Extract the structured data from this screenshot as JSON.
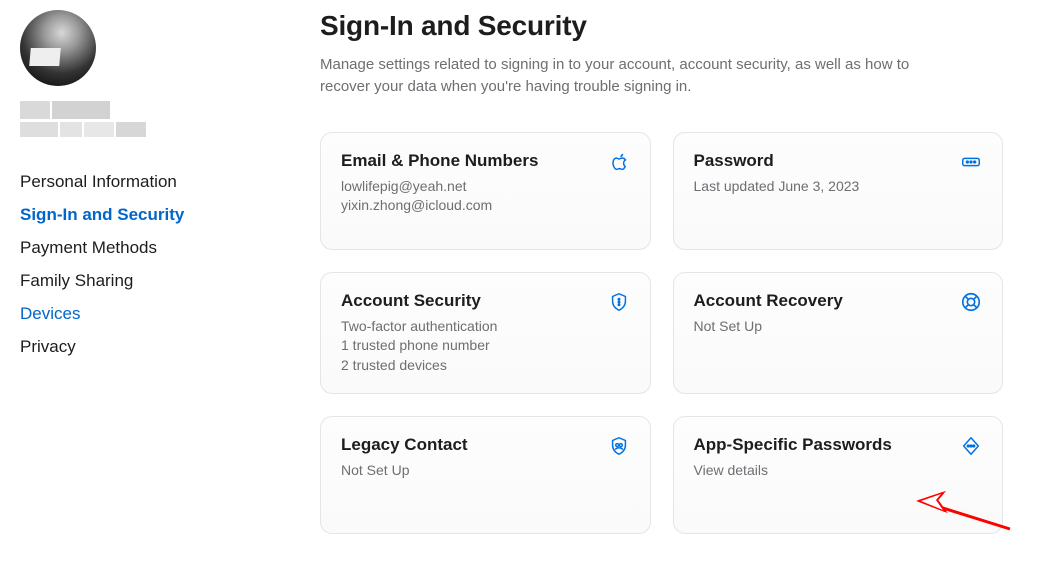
{
  "sidebar": {
    "items": [
      {
        "label": "Personal Information",
        "state": "default"
      },
      {
        "label": "Sign-In and Security",
        "state": "active"
      },
      {
        "label": "Payment Methods",
        "state": "default"
      },
      {
        "label": "Family Sharing",
        "state": "default"
      },
      {
        "label": "Devices",
        "state": "link"
      },
      {
        "label": "Privacy",
        "state": "default"
      }
    ]
  },
  "header": {
    "title": "Sign-In and Security",
    "description": "Manage settings related to signing in to your account, account security, as well as how to recover your data when you're having trouble signing in."
  },
  "cards": {
    "email_phone": {
      "title": "Email & Phone Numbers",
      "line1": "lowlifepig@yeah.net",
      "line2": "yixin.zhong@icloud.com",
      "icon": "apple-icon"
    },
    "password": {
      "title": "Password",
      "line1": "Last updated June 3, 2023",
      "icon": "password-dots-icon"
    },
    "account_security": {
      "title": "Account Security",
      "line1": "Two-factor authentication",
      "line2": "1 trusted phone number",
      "line3": "2 trusted devices",
      "icon": "shield-dots-icon"
    },
    "account_recovery": {
      "title": "Account Recovery",
      "line1": "Not Set Up",
      "icon": "lifebuoy-icon"
    },
    "legacy_contact": {
      "title": "Legacy Contact",
      "line1": "Not Set Up",
      "icon": "shield-people-icon"
    },
    "app_specific": {
      "title": "App-Specific Passwords",
      "line1": "View details",
      "icon": "diamond-dots-icon"
    }
  },
  "colors": {
    "accent": "#0071e3",
    "text_secondary": "#6e6e73",
    "annotation": "#ff0000"
  }
}
